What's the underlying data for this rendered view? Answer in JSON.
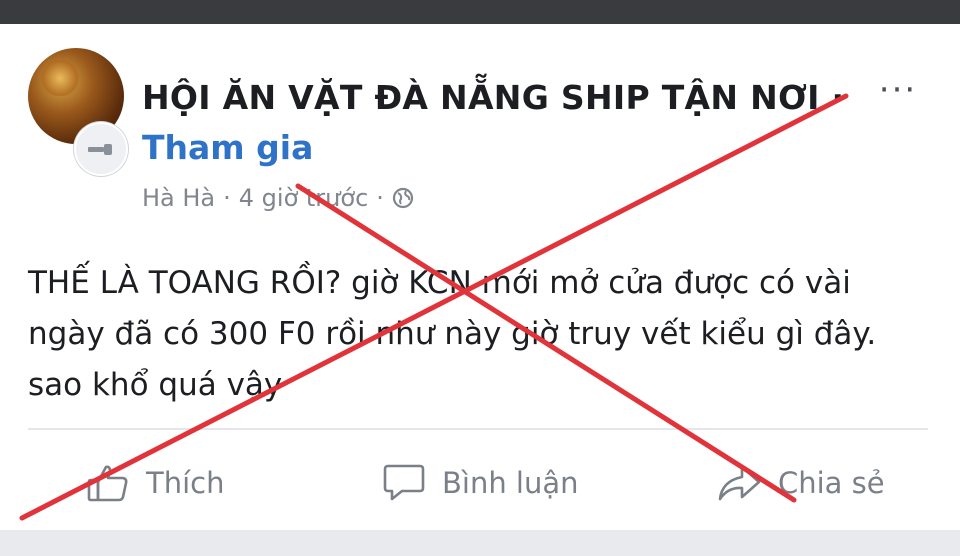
{
  "post": {
    "group_name": "HỘI ĂN VẶT ĐÀ NẴNG SHIP TẬN NƠI ·",
    "join_label": "Tham gia",
    "author": "Hà Hà",
    "separator": "·",
    "timestamp": "4 giờ trước",
    "body": "THẾ LÀ TOANG RỒI? giờ KCN mới mở cửa được có vài ngày đã có 300 F0 rồi như này giờ truy vết kiểu gì đây. sao khổ quá vậy",
    "more_label": "···"
  },
  "actions": {
    "like_label": "Thích",
    "comment_label": "Bình luận",
    "share_label": "Chia sẻ"
  },
  "overlay": {
    "cross_color": "#e0343a"
  }
}
